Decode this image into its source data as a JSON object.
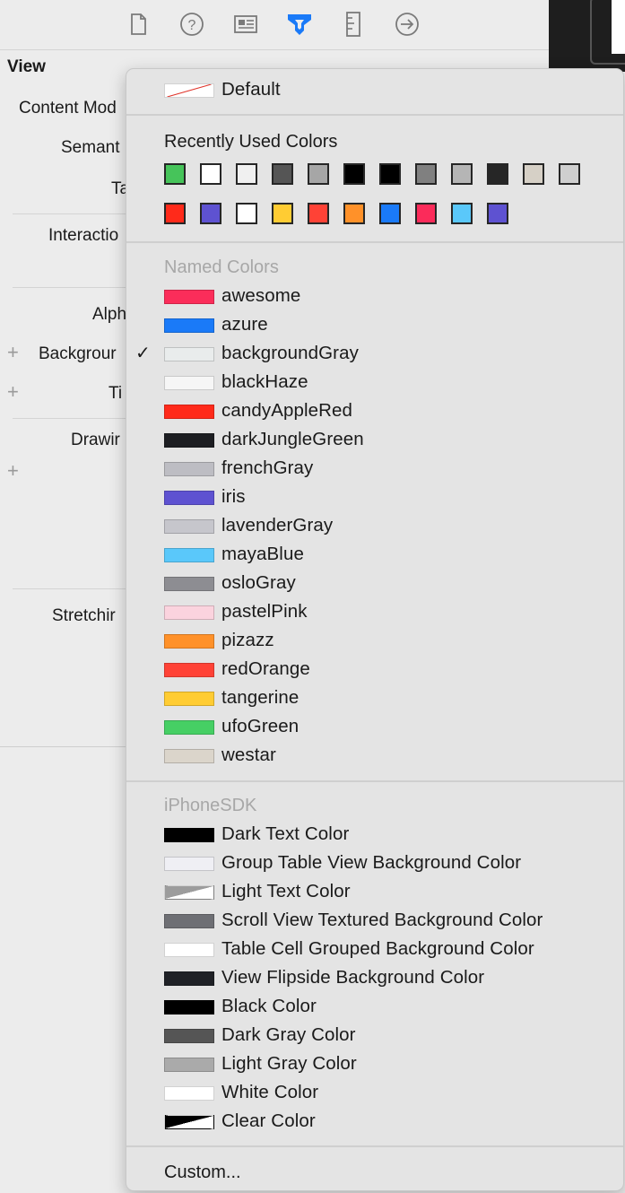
{
  "toolbar": {
    "icons": [
      "file-inspector-icon",
      "help-icon",
      "identity-inspector-icon",
      "attributes-inspector-icon",
      "size-inspector-icon",
      "connections-inspector-icon"
    ]
  },
  "inspector": {
    "section_title": "View",
    "labels": {
      "content_mode": "Content Mod",
      "semantic": "Semant",
      "tag": "Ta",
      "interaction": "Interactio",
      "alpha": "Alph",
      "background": "Backgrour",
      "tint": "Ti",
      "drawing": "Drawir",
      "stretching": "Stretchir"
    }
  },
  "menu": {
    "default_label": "Default",
    "recent_heading": "Recently Used Colors",
    "recent_row1": [
      "#46c45a",
      "#ffffff",
      "#f0f0f0",
      "#555555",
      "#a6a6a6",
      "#000000",
      "#000000",
      "#808080",
      "#b5b5b5",
      "#262626",
      "#d6d0c6",
      "#cfcfcf"
    ],
    "recent_row2": [
      "#ff2a1a",
      "#5e52d1",
      "#ffffff",
      "#ffcc33",
      "#ff4236",
      "#ff9129",
      "#1a7af8",
      "#fb2b5a",
      "#5ac8fa",
      "#5e52d1"
    ],
    "named_heading": "Named Colors",
    "named": [
      {
        "label": "awesome",
        "color": "#fb2d5a"
      },
      {
        "label": "azure",
        "color": "#1a7af8"
      },
      {
        "label": "backgroundGray",
        "color": "#e9ecec",
        "checked": true
      },
      {
        "label": "blackHaze",
        "color": "#f6f6f6"
      },
      {
        "label": "candyAppleRed",
        "color": "#ff2a1a"
      },
      {
        "label": "darkJungleGreen",
        "color": "#1d1e22"
      },
      {
        "label": "frenchGray",
        "color": "#bdbdc3"
      },
      {
        "label": "iris",
        "color": "#5e52d1"
      },
      {
        "label": "lavenderGray",
        "color": "#c6c6cc"
      },
      {
        "label": "mayaBlue",
        "color": "#5ac8fa"
      },
      {
        "label": "osloGray",
        "color": "#8d8d92"
      },
      {
        "label": "pastelPink",
        "color": "#fbd3de"
      },
      {
        "label": "pizazz",
        "color": "#ff9129"
      },
      {
        "label": "redOrange",
        "color": "#ff4236"
      },
      {
        "label": "tangerine",
        "color": "#ffcc33"
      },
      {
        "label": "ufoGreen",
        "color": "#46cf64"
      },
      {
        "label": "westar",
        "color": "#dbd5cb"
      }
    ],
    "sdk_heading": "iPhoneSDK",
    "sdk": [
      {
        "label": "Dark Text Color",
        "color": "#000000"
      },
      {
        "label": "Group Table View Background Color",
        "color": "#efeff4"
      },
      {
        "label": "Light Text Color",
        "color": "#9c9c9c",
        "split": "light"
      },
      {
        "label": "Scroll View Textured Background Color",
        "color": "#6e6f74"
      },
      {
        "label": "Table Cell Grouped Background Color",
        "color": "#ffffff"
      },
      {
        "label": "View Flipside Background Color",
        "color": "#1f2126"
      },
      {
        "label": "Black Color",
        "color": "#000000"
      },
      {
        "label": "Dark Gray Color",
        "color": "#555555"
      },
      {
        "label": "Light Gray Color",
        "color": "#aaaaaa"
      },
      {
        "label": "White Color",
        "color": "#ffffff"
      },
      {
        "label": "Clear Color",
        "color": "#000000",
        "split": "clear"
      }
    ],
    "custom_label": "Custom..."
  }
}
